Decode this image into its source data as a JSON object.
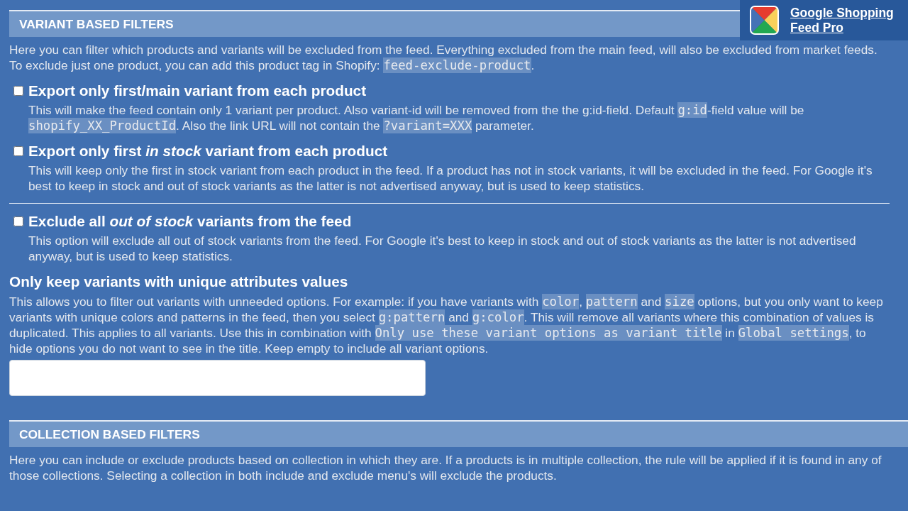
{
  "badge": {
    "title": "Google Shopping Feed Pro"
  },
  "variant_filters": {
    "header": "VARIANT BASED FILTERS",
    "intro": [
      {
        "kind": "text",
        "text": "Here you can filter which products and variants will be excluded from the feed. Everything excluded from the main feed, will also be excluded from market feeds. To exclude just one product, you can add this product tag in Shopify: "
      },
      {
        "kind": "code",
        "text": "feed-exclude-product"
      },
      {
        "kind": "text",
        "text": "."
      }
    ],
    "option_groups": [
      {
        "options": [
          {
            "label": "Export only first/main variant from each product",
            "checked": false,
            "description": [
              {
                "kind": "text",
                "text": "This will make the feed contain only 1 variant per product. Also variant-id will be removed from the the g:id-field. Default "
              },
              {
                "kind": "code",
                "text": "g:id"
              },
              {
                "kind": "text",
                "text": "-field value will be "
              },
              {
                "kind": "code",
                "text": "shopify_XX_ProductId"
              },
              {
                "kind": "text",
                "text": ". Also the link URL will not contain the "
              },
              {
                "kind": "code",
                "text": "?variant=XXX"
              },
              {
                "kind": "text",
                "text": " parameter."
              }
            ]
          },
          {
            "label": "Export only first *in stock* variant from each product",
            "checked": false,
            "description": [
              {
                "kind": "text",
                "text": "This will keep only the first in stock variant from each product in the feed. If a product has not in stock variants, it will be excluded in the feed. For Google it's best to keep in stock and out of stock variants as the latter is not advertised anyway, but is used to keep statistics."
              }
            ]
          }
        ]
      },
      {
        "options": [
          {
            "label": "Exclude all *out of stock* variants from the feed",
            "checked": false,
            "description": [
              {
                "kind": "text",
                "text": "This option will exclude all out of stock variants from the feed. For Google it's best to keep in stock and out of stock variants as the latter is not advertised anyway, but is used to keep statistics."
              }
            ]
          }
        ]
      }
    ],
    "unique_attributes": {
      "heading": "Only keep variants with unique attributes values",
      "description": [
        {
          "kind": "text",
          "text": "This allows you to filter out variants with unneeded options. For example: if you have variants with "
        },
        {
          "kind": "code",
          "text": "color"
        },
        {
          "kind": "text",
          "text": ", "
        },
        {
          "kind": "code",
          "text": "pattern"
        },
        {
          "kind": "text",
          "text": " and "
        },
        {
          "kind": "code",
          "text": "size"
        },
        {
          "kind": "text",
          "text": " options, but you only want to keep variants with unique colors and patterns in the feed, then you select "
        },
        {
          "kind": "code",
          "text": "g:pattern"
        },
        {
          "kind": "text",
          "text": " and "
        },
        {
          "kind": "code",
          "text": "g:color"
        },
        {
          "kind": "text",
          "text": ". This will remove all variants where this combination of values is duplicated. This applies to all variants. Use this in combination with "
        },
        {
          "kind": "code",
          "text": "Only use these variant options as variant title"
        },
        {
          "kind": "text",
          "text": " in "
        },
        {
          "kind": "code",
          "text": "Global settings"
        },
        {
          "kind": "text",
          "text": ", to hide options you do not want to see in the title. Keep empty to include all variant options."
        }
      ]
    }
  },
  "collection_filters": {
    "header": "COLLECTION BASED FILTERS",
    "intro": [
      {
        "kind": "text",
        "text": "Here you can include or exclude products based on collection in which they are. If a products is in multiple collection, the rule will be applied if it is found in any of those collections. Selecting a collection in both include and exclude menu's will exclude the products."
      }
    ]
  }
}
